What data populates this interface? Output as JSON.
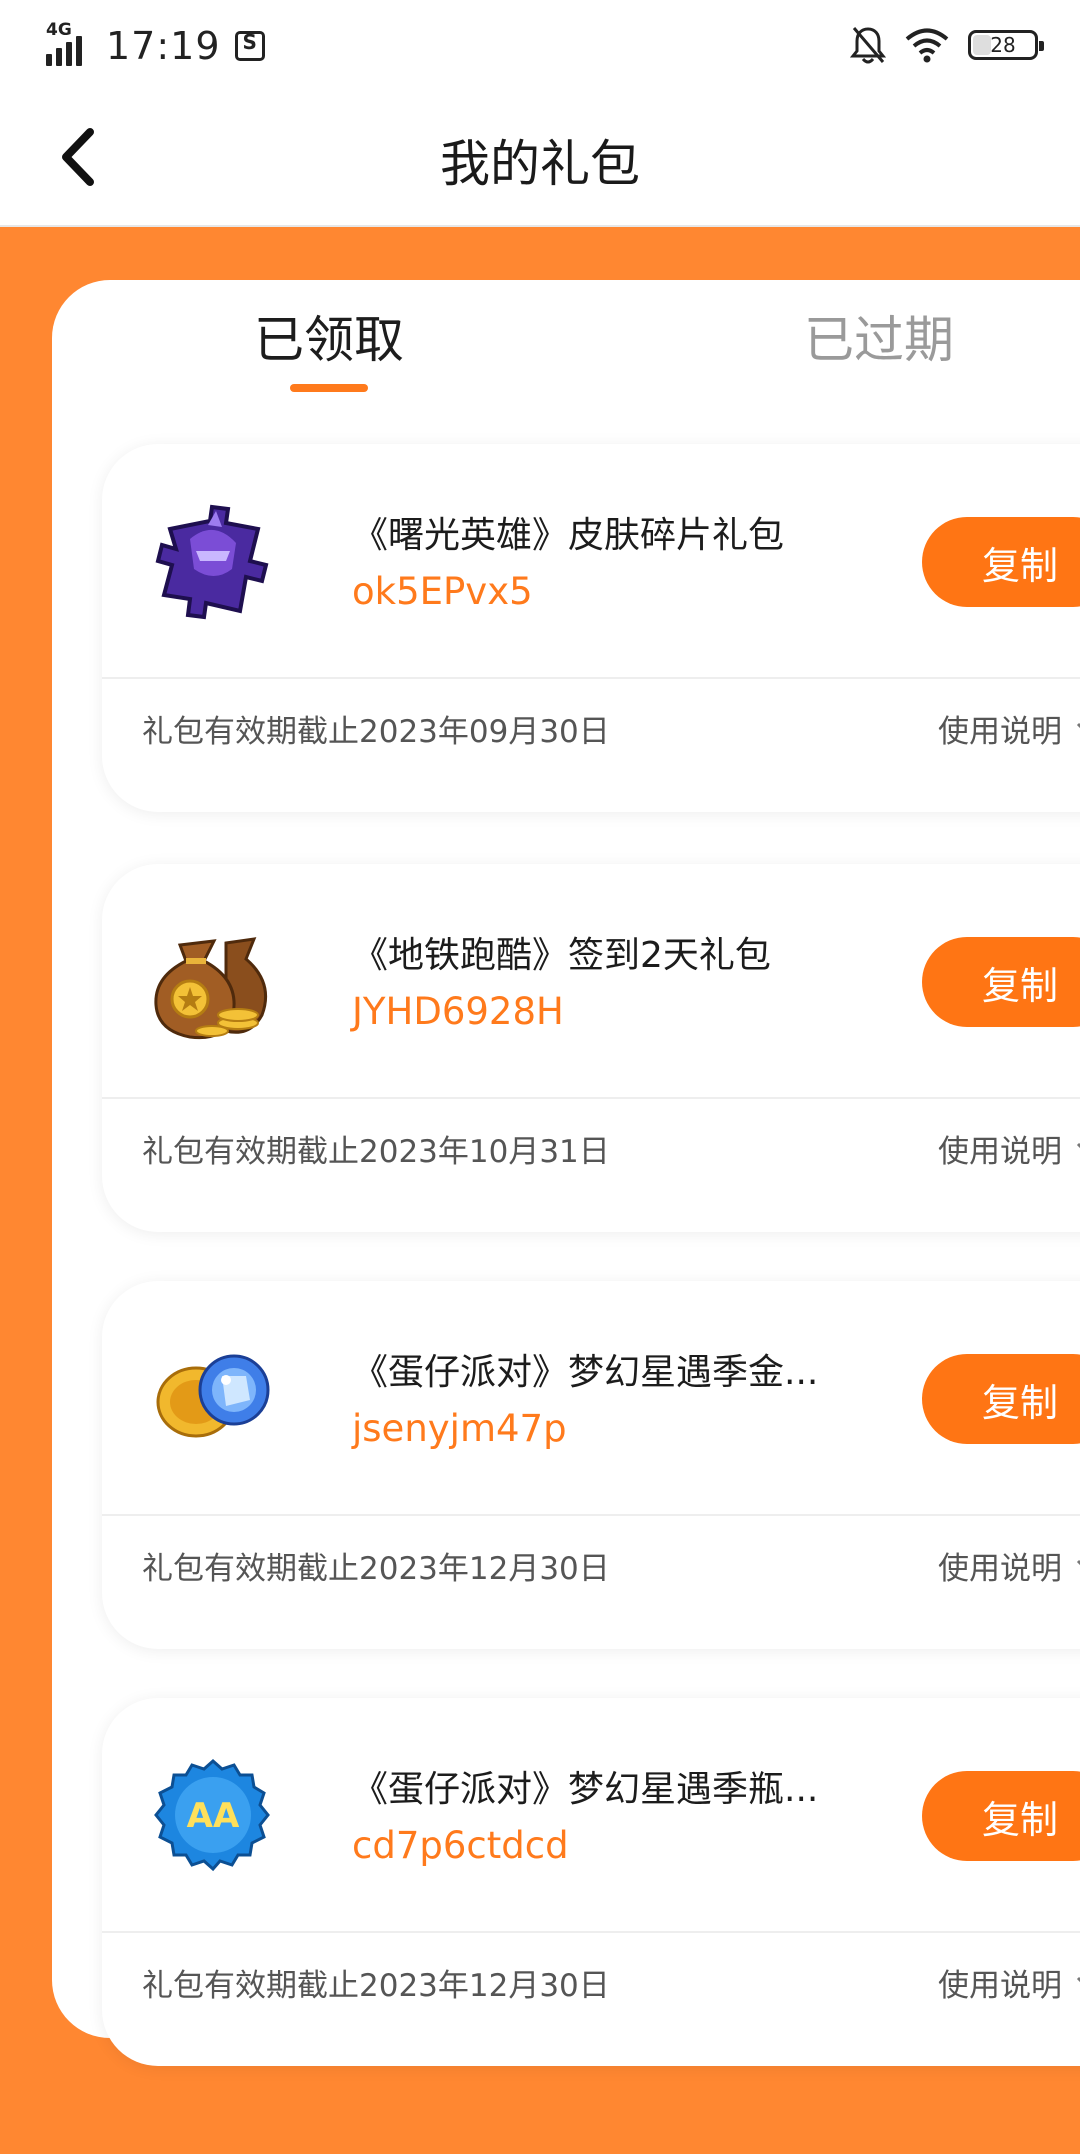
{
  "status_bar": {
    "network": "4G",
    "time": "17:19",
    "battery": "28"
  },
  "header": {
    "title": "我的礼包"
  },
  "tabs": [
    {
      "label": "已领取",
      "active": true
    },
    {
      "label": "已过期",
      "active": false
    }
  ],
  "gifts": [
    {
      "title": "《曙光英雄》皮肤碎片礼包",
      "code": "ok5EPvx5",
      "copy_label": "复制",
      "expire": "礼包有效期截止2023年09月30日",
      "usage_label": "使用说明",
      "icon": "purple-puzzle-hero-icon"
    },
    {
      "title": "《地铁跑酷》签到2天礼包",
      "code": "JYHD6928H",
      "copy_label": "复制",
      "expire": "礼包有效期截止2023年10月31日",
      "usage_label": "使用说明",
      "icon": "coin-bags-icon"
    },
    {
      "title": "《蛋仔派对》梦幻星遇季金...",
      "code": "jsenyjm47p",
      "copy_label": "复制",
      "expire": "礼包有效期截止2023年12月30日",
      "usage_label": "使用说明",
      "icon": "gold-coin-blue-dice-icon"
    },
    {
      "title": "《蛋仔派对》梦幻星遇季瓶...",
      "code": "cd7p6ctdcd",
      "copy_label": "复制",
      "expire": "礼包有效期截止2023年12月30日",
      "usage_label": "使用说明",
      "icon": "bottle-cap-icon"
    }
  ],
  "colors": {
    "accent": "#ff7a1c",
    "background": "#ff8731"
  }
}
